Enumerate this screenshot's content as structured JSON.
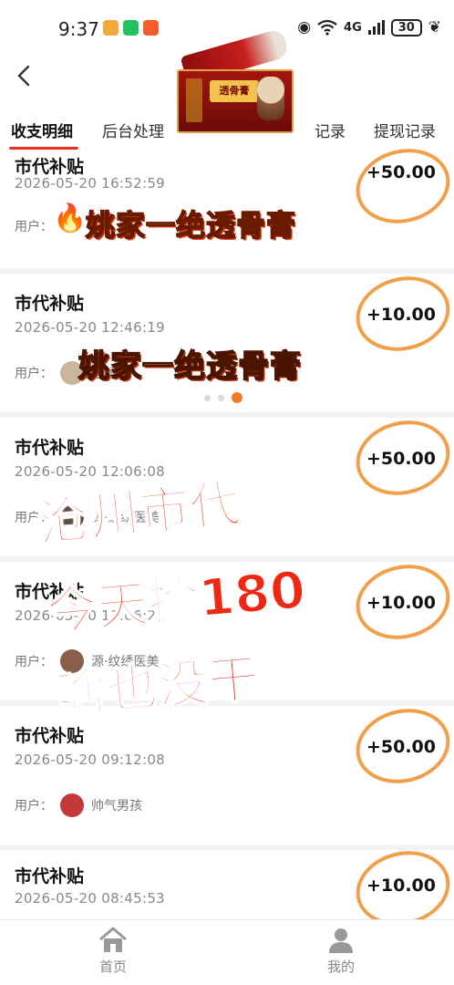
{
  "status_bar": {
    "time": "9:37",
    "network": "4G",
    "battery": "30",
    "colors": {
      "app1": "#f2a93a",
      "app2": "#22c35e",
      "app3": "#f45c2c"
    }
  },
  "header": {
    "back_icon": "chevron-left-icon",
    "tabs": [
      {
        "label": "收支明细",
        "active": true
      },
      {
        "label": "后台处理",
        "active": false
      },
      {
        "label": "记录",
        "active": false
      },
      {
        "label": "提现记录",
        "active": false
      }
    ]
  },
  "product": {
    "box_text": "透骨膏"
  },
  "records": [
    {
      "title": "市代补贴",
      "time": "2026-05-20 16:52:59",
      "amount": "+50.00",
      "user_label": "用户：",
      "user_name": ""
    },
    {
      "title": "市代补贴",
      "time": "2026-05-20 12:46:19",
      "amount": "+10.00",
      "user_label": "用户：",
      "user_name": "超超"
    },
    {
      "title": "市代补贴",
      "time": "2026-05-20 12:06:08",
      "amount": "+50.00",
      "user_label": "用户：",
      "user_name": "源·纹绣医美"
    },
    {
      "title": "市代补贴",
      "time": "2026-05-20 11:06:21",
      "amount": "+10.00",
      "user_label": "用户：",
      "user_name": "源·纹绣医美"
    },
    {
      "title": "市代补贴",
      "time": "2026-05-20 09:12:08",
      "amount": "+50.00",
      "user_label": "用户：",
      "user_name": "帅气男孩"
    },
    {
      "title": "市代补贴",
      "time": "2026-05-20 08:45:53",
      "amount": "+10.00",
      "user_label": "",
      "user_name": ""
    }
  ],
  "overlay": {
    "promo_top": "姚家一绝透骨膏",
    "promo_mid": "姚家一绝透骨膏",
    "line1": "沧州市代",
    "line2": "今天捡180",
    "line3": "啥也没干"
  },
  "bottom_nav": [
    {
      "label": "首页",
      "icon": "home-icon"
    },
    {
      "label": "我的",
      "icon": "user-icon"
    }
  ],
  "colors": {
    "accent": "#e4331c",
    "circle": "#f0a04a",
    "caption_red": "#ef2814"
  }
}
